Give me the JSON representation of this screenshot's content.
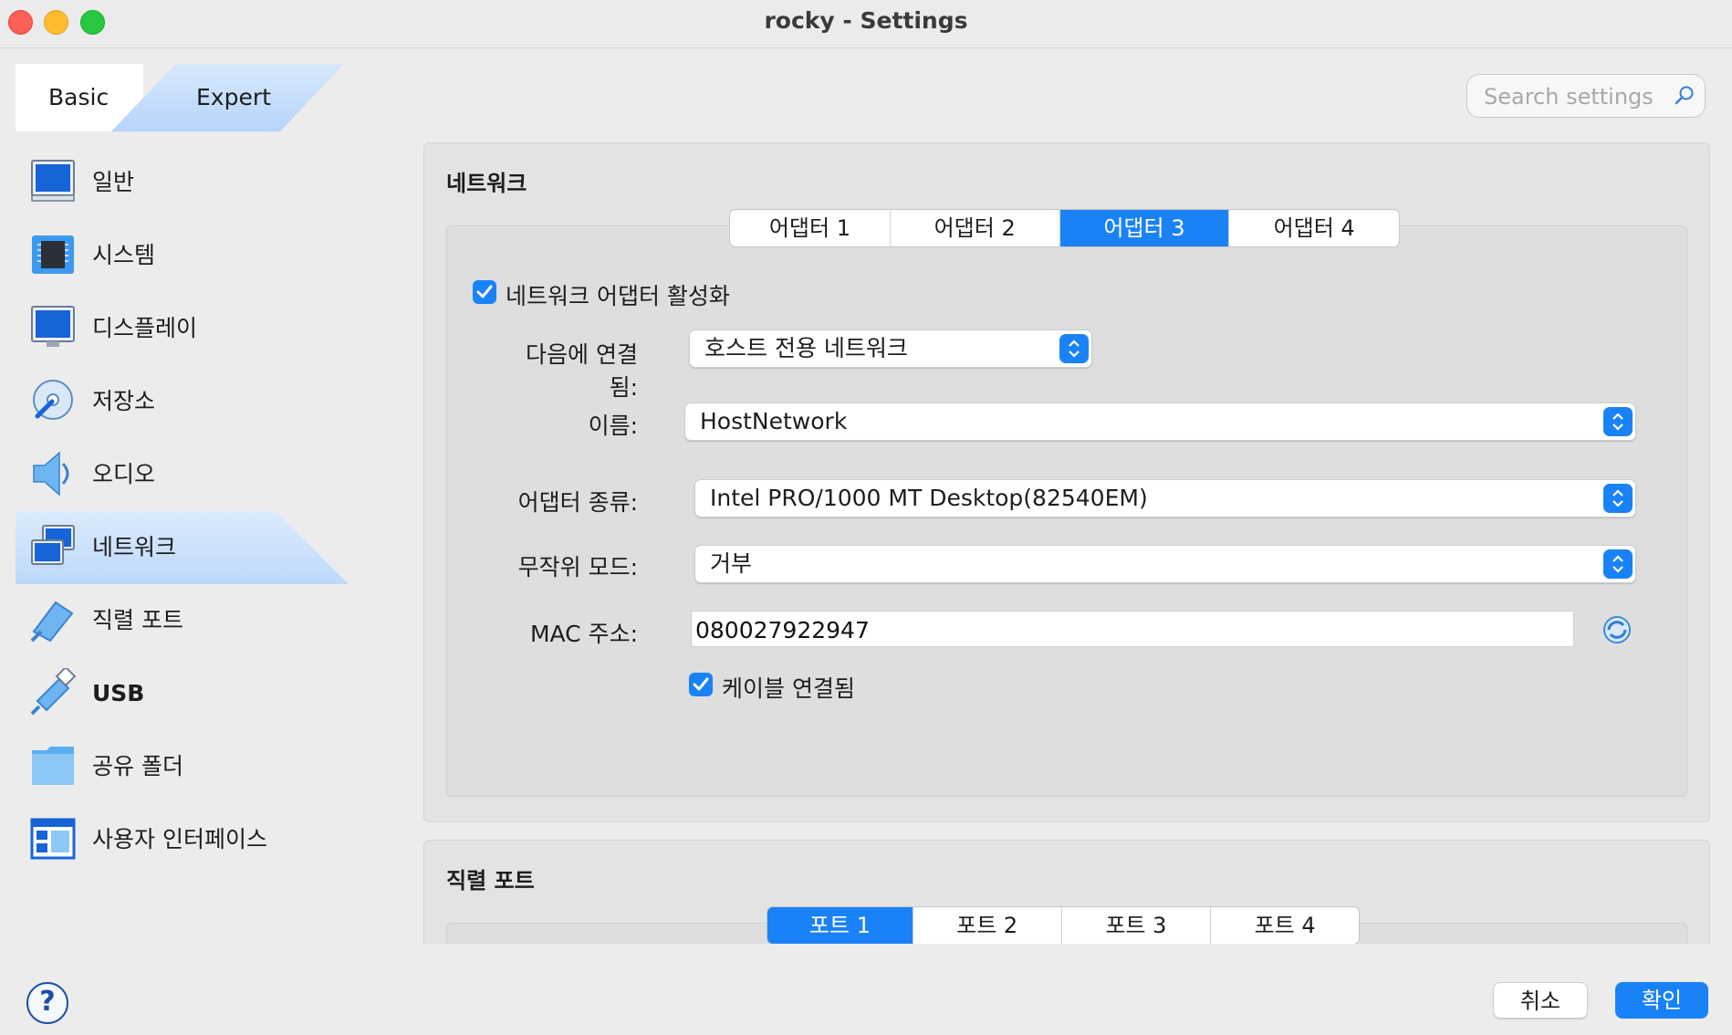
{
  "window": {
    "title": "rocky - Settings"
  },
  "mode": {
    "basic": "Basic",
    "expert": "Expert"
  },
  "search": {
    "placeholder": "Search settings"
  },
  "sidebar": {
    "items": [
      {
        "label": "일반",
        "icon": "monitor-icon"
      },
      {
        "label": "시스템",
        "icon": "chip-icon"
      },
      {
        "label": "디스플레이",
        "icon": "display-icon"
      },
      {
        "label": "저장소",
        "icon": "disk-icon"
      },
      {
        "label": "오디오",
        "icon": "speaker-icon"
      },
      {
        "label": "네트워크",
        "icon": "network-icon",
        "selected": true
      },
      {
        "label": "직렬 포트",
        "icon": "serial-port-icon"
      },
      {
        "label": "USB",
        "icon": "usb-icon"
      },
      {
        "label": "공유 폴더",
        "icon": "folder-icon"
      },
      {
        "label": "사용자 인터페이스",
        "icon": "ui-window-icon"
      }
    ]
  },
  "network": {
    "title": "네트워크",
    "tabs": [
      "어댑터 1",
      "어댑터 2",
      "어댑터 3",
      "어댑터 4"
    ],
    "active_tab": "어댑터 3",
    "enable_label": "네트워크 어댑터 활성화",
    "enable_checked": true,
    "attached_label": "다음에 연결됨:",
    "attached_value": "호스트 전용 네트워크",
    "name_label": "이름:",
    "name_value": "HostNetwork",
    "adapter_type_label": "어댑터 종류:",
    "adapter_type_value": "Intel PRO/1000 MT Desktop(82540EM)",
    "promisc_label": "무작위 모드:",
    "promisc_value": "거부",
    "mac_label": "MAC 주소:",
    "mac_value": "080027922947",
    "cable_label": "케이블 연결됨",
    "cable_checked": true
  },
  "serial": {
    "title": "직렬 포트",
    "tabs": [
      "포트 1",
      "포트 2",
      "포트 3",
      "포트 4"
    ],
    "active_tab": "포트 1"
  },
  "buttons": {
    "cancel": "취소",
    "ok": "확인",
    "help": "?"
  },
  "colors": {
    "accent": "#1a82f7",
    "selection": "#cfe3fb"
  }
}
